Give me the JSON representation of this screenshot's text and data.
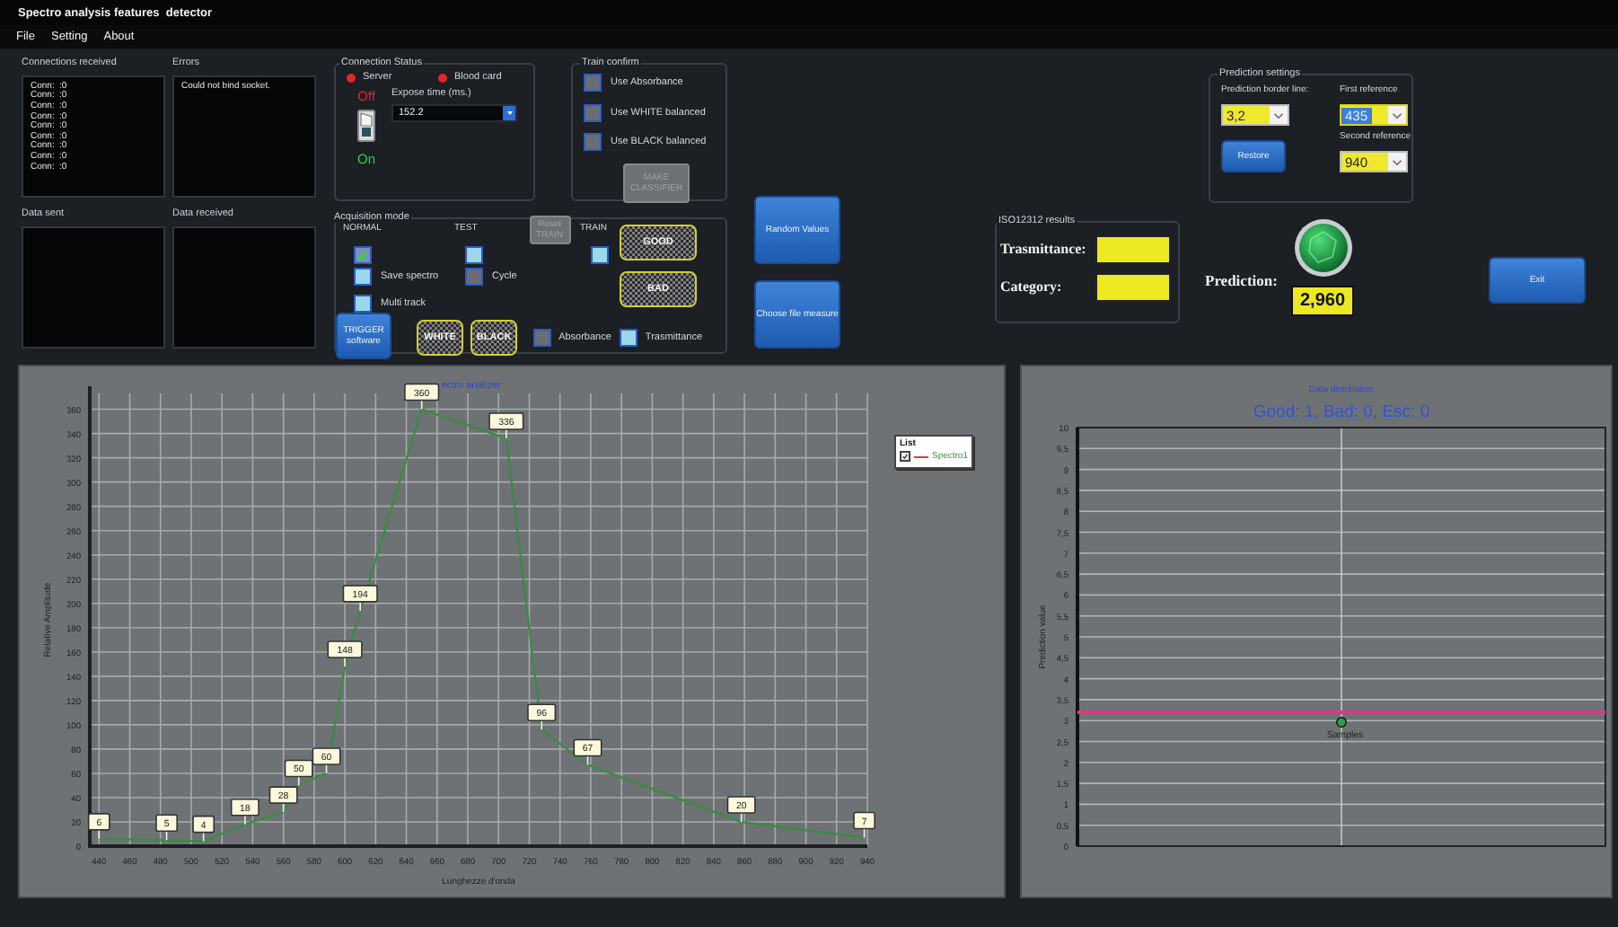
{
  "window": {
    "title": "Spectro analysis features  detector"
  },
  "menu": [
    {
      "label": "File"
    },
    {
      "label": "Setting"
    },
    {
      "label": "About"
    }
  ],
  "logs": [
    {
      "label": "Connections received",
      "lines": [
        {
          "text": "Conn:",
          "value": ":0"
        },
        {
          "text": "Conn:",
          "value": ":0"
        },
        {
          "text": "Conn:",
          "value": ":0"
        },
        {
          "text": "Conn:",
          "value": ":0"
        },
        {
          "text": "Conn:",
          "value": ":0"
        },
        {
          "text": "Conn:",
          "value": ":0"
        },
        {
          "text": "Conn:",
          "value": ":0"
        },
        {
          "text": "Conn:",
          "value": ":0"
        },
        {
          "text": "Conn:",
          "value": ":0"
        }
      ]
    },
    {
      "label": "Errors",
      "lines": [
        {
          "text": "Could not bind socket."
        }
      ]
    },
    {
      "label": "Data sent"
    },
    {
      "label": "Data received"
    }
  ],
  "connection_status": {
    "title": "Connection Status",
    "indicators": [
      {
        "label": "Server",
        "color": "#e32626"
      },
      {
        "label": "Blood card",
        "color": "#e32626"
      }
    ],
    "switch": {
      "off_label": "Off",
      "on_label": "On"
    },
    "expose_time": {
      "label": "Expose time (ms.)",
      "value": "152.2"
    }
  },
  "train_confirm": {
    "title": "Train confirm",
    "options": [
      {
        "label": "Use Absorbance",
        "checked": false,
        "disabled": true
      },
      {
        "label": "Use WHITE balanced",
        "checked": false,
        "disabled": true
      },
      {
        "label": "Use BLACK balanced",
        "checked": false,
        "disabled": true
      }
    ],
    "button": {
      "label": "MAKE CLASSIFIER",
      "disabled": true
    }
  },
  "acquisition_mode": {
    "title": "Acquisition mode",
    "columns": [
      {
        "header": "NORMAL",
        "checked": true,
        "disabled": false
      },
      {
        "header": "TEST",
        "checked": false,
        "disabled": false
      }
    ],
    "reset_button": {
      "label": "Reset TRAIN",
      "disabled": true
    },
    "train": {
      "header": "TRAIN",
      "checked": false,
      "disabled": false
    },
    "class_buttons": [
      {
        "label": "GOOD"
      },
      {
        "label": "BAD"
      }
    ],
    "options": [
      {
        "label": "Save spectro",
        "checked": false,
        "disabled": false
      },
      {
        "label": "Cycle",
        "checked": false,
        "disabled": true
      },
      {
        "label": "Multi track",
        "checked": false,
        "disabled": false
      }
    ],
    "trigger_button": {
      "label": "TRIGGER software"
    },
    "reference_buttons": [
      {
        "label": "WHITE"
      },
      {
        "label": "BLACK"
      }
    ],
    "mode_options": [
      {
        "label": "Absorbance",
        "checked": false,
        "disabled": true
      },
      {
        "label": "Trasmittance",
        "checked": false,
        "disabled": false
      }
    ]
  },
  "actions": [
    {
      "label": "Random Values"
    },
    {
      "label": "Choose file measure"
    }
  ],
  "iso_results": {
    "title": "ISO12312 results",
    "fields": [
      {
        "label": "Trasmittance:"
      },
      {
        "label": "Category:"
      }
    ]
  },
  "prediction_settings": {
    "title": "Prediction settings",
    "border_line": {
      "label": "Prediction border line:",
      "value": "3,2",
      "focused": false
    },
    "first_reference": {
      "label": "First reference",
      "value": "435",
      "focused": true
    },
    "restore_button": {
      "label": "Restore"
    },
    "second_reference": {
      "label": "Second reference",
      "value": "940",
      "focused": false
    }
  },
  "prediction": {
    "label": "Prediction:",
    "value": "2,960"
  },
  "exit_button": {
    "label": "Exit"
  },
  "spectrum_chart": {
    "legend": {
      "title": "List",
      "checked": true
    },
    "chart_data": {
      "type": "line",
      "title": "ectro analizer",
      "xlabel": "Lunghezze d'onda",
      "ylabel": "Relative Amplitude",
      "x": [
        440,
        484,
        508,
        535,
        560,
        570,
        588,
        600,
        610,
        650,
        705,
        728,
        758,
        858,
        938
      ],
      "series": [
        {
          "name": "Spectro1",
          "color": "#3b8c45",
          "values": [
            6,
            5,
            4,
            18,
            28,
            50,
            60,
            148,
            194,
            360,
            336,
            96,
            67,
            20,
            7
          ]
        }
      ],
      "xlim": [
        434,
        940
      ],
      "ylim": [
        0,
        373
      ],
      "xticks": [
        440,
        460,
        480,
        500,
        520,
        540,
        560,
        580,
        600,
        620,
        640,
        660,
        680,
        700,
        720,
        740,
        760,
        780,
        800,
        820,
        840,
        860,
        880,
        900,
        920,
        940
      ],
      "yticks": [
        0,
        20,
        40,
        60,
        80,
        100,
        120,
        140,
        160,
        180,
        200,
        220,
        240,
        260,
        280,
        300,
        320,
        340,
        360
      ],
      "grid": true,
      "data_labels": true
    }
  },
  "distribution_chart": {
    "summary": "Good: 1, Bad: 0, Esc: 0",
    "chart_data": {
      "type": "scatter",
      "title": "Data distribution",
      "ylabel": "Prediction value",
      "categories": [
        null
      ],
      "series": [
        {
          "name": "Samples",
          "color": "#2f9e4f",
          "values": [
            2.96
          ]
        }
      ],
      "ylim": [
        0,
        10
      ],
      "grid": true,
      "yticks": [
        {
          "value": 0,
          "label": "0"
        },
        {
          "value": 0.5,
          "label": "0,5"
        },
        {
          "value": 1,
          "label": "1"
        },
        {
          "value": 1.5,
          "label": "1,5"
        },
        {
          "value": 2,
          "label": "2"
        },
        {
          "value": 2.5,
          "label": "2,5"
        },
        {
          "value": 3,
          "label": "3"
        },
        {
          "value": 3.5,
          "label": "3,5"
        },
        {
          "value": 4,
          "label": "4"
        },
        {
          "value": 4.5,
          "label": "4,5"
        },
        {
          "value": 5,
          "label": "5"
        },
        {
          "value": 5.5,
          "label": "5,5"
        },
        {
          "value": 6,
          "label": "6"
        },
        {
          "value": 6.5,
          "label": "6,5"
        },
        {
          "value": 7,
          "label": "7"
        },
        {
          "value": 7.5,
          "label": "7,5"
        },
        {
          "value": 8,
          "label": "8"
        },
        {
          "value": 8.5,
          "label": "8,5"
        },
        {
          "value": 9,
          "label": "9"
        },
        {
          "value": 9.5,
          "label": "9,5"
        },
        {
          "value": 10,
          "label": "10"
        }
      ],
      "ref_lines": [
        {
          "axis": "y",
          "value": 3.2,
          "color": "#e3338a"
        }
      ]
    }
  }
}
